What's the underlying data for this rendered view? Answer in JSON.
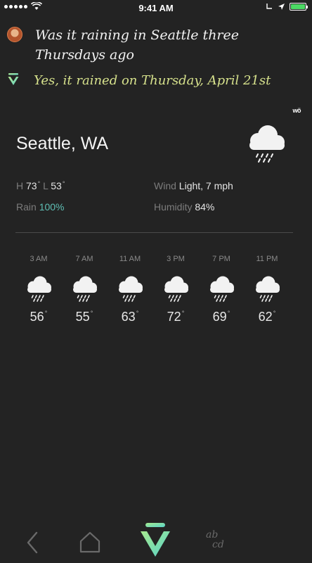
{
  "status_bar": {
    "time": "9:41 AM"
  },
  "query": {
    "text": "Was it raining in Seattle three Thursdays ago"
  },
  "answer": {
    "text": "Yes, it rained on Thursday, April 21st"
  },
  "badge": {
    "text": "wö"
  },
  "weather": {
    "city": "Seattle, WA",
    "condition_icon": "rain-cloud-icon",
    "high_label": "H",
    "high_value": "73",
    "low_label": "L",
    "low_value": "53",
    "rain_label": "Rain",
    "rain_value": "100%",
    "wind_label": "Wind",
    "wind_value": "Light, 7 mph",
    "humidity_label": "Humidity",
    "humidity_value": "84%",
    "hourly": [
      {
        "time": "3 AM",
        "temp": "56"
      },
      {
        "time": "7 AM",
        "temp": "55"
      },
      {
        "time": "11 AM",
        "temp": "63"
      },
      {
        "time": "3 PM",
        "temp": "72"
      },
      {
        "time": "7 PM",
        "temp": "69"
      },
      {
        "time": "11 PM",
        "temp": "62"
      }
    ]
  },
  "nav": {
    "back_icon": "chevron-left-icon",
    "home_icon": "home-icon",
    "assistant_icon": "assistant-logo-icon",
    "keyboard_label_top": "ab",
    "keyboard_label_bottom": "cd"
  },
  "colors": {
    "background": "#232323",
    "accent_answer": "#d6e18c",
    "rain_value": "#5fbfb5",
    "logo_gradient": [
      "#9ee6a0",
      "#5fd3c7"
    ]
  }
}
